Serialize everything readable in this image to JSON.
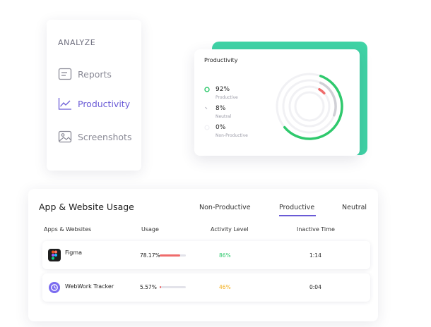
{
  "sidebar": {
    "heading": "ANALYZE",
    "items": [
      {
        "label": "Reports",
        "icon": "report-icon"
      },
      {
        "label": "Productivity",
        "icon": "line-chart-icon"
      },
      {
        "label": "Screenshots",
        "icon": "image-icon"
      }
    ],
    "active_index": 1
  },
  "productivity_card": {
    "title": "Productivity",
    "stats": [
      {
        "value": "92%",
        "label": "Productive",
        "color": "#2fc96d",
        "fraction": 0.92
      },
      {
        "value": "8%",
        "label": "Neutral",
        "color": "#c8c8cf",
        "fraction": 0.08
      },
      {
        "value": "0%",
        "label": "Non-Productive",
        "color": "#ef6b6b",
        "fraction": 0.0
      }
    ]
  },
  "usage": {
    "title": "App & Website Usage",
    "tabs": [
      "Non-Productive",
      "Productive",
      "Neutral"
    ],
    "active_tab": "Productive",
    "columns": [
      "Apps & Websites",
      "Usage",
      "Activity Level",
      "Inactive Time"
    ],
    "rows": [
      {
        "app": "Figma",
        "icon": "figma-icon",
        "usage": "78.17%",
        "usage_fraction": 0.7817,
        "activity": "86%",
        "activity_color": "#2fc96d",
        "inactive": "1:14"
      },
      {
        "app": "WebWork Tracker",
        "icon": "webwork-tracker-icon",
        "usage": "5.57%",
        "usage_fraction": 0.0557,
        "activity": "46%",
        "activity_color": "#f3b020",
        "inactive": "0:04"
      }
    ]
  },
  "colors": {
    "accent": "#6a5bd6",
    "green": "#3fd3a5",
    "productive": "#2fc96d",
    "bar_fill": "#ef6b6b"
  }
}
